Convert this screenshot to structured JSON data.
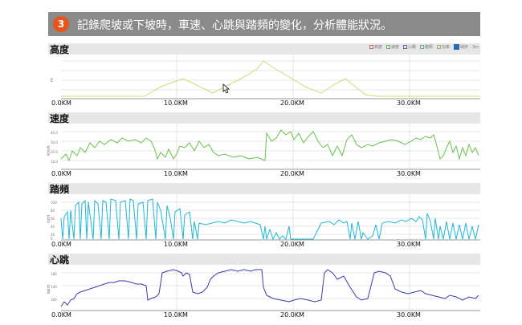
{
  "banner": {
    "step": "3",
    "title": "記錄爬坡或下坡時，車速、心跳與踏頻的變化，分析體能狀況。"
  },
  "legend": [
    {
      "label": "高度",
      "color": "#c66"
    },
    {
      "label": "速度",
      "color": "#6a6"
    },
    {
      "label": "心跳",
      "color": "#66a"
    },
    {
      "label": "踏頻",
      "color": "#6aa"
    },
    {
      "label": "功率",
      "color": "#aa6"
    }
  ],
  "legend_extra": [
    "儲存",
    "3m"
  ],
  "x_ticks": [
    "0.0KM",
    "10.0KM",
    "20.0KM",
    "30.0KM"
  ],
  "panels": [
    {
      "key": "altitude",
      "title": "高度",
      "unit": "m",
      "color": "#d4d870"
    },
    {
      "key": "speed",
      "title": "速度",
      "unit": "km/h",
      "color": "#66c24a",
      "y_ticks": [
        "40.0",
        "30.0",
        "20.0",
        "10.0"
      ]
    },
    {
      "key": "cadence",
      "title": "踏頻",
      "unit": "rpm",
      "color": "#1cb8d8",
      "y_ticks": [
        "100",
        "80",
        "60",
        "40",
        "20",
        "0"
      ]
    },
    {
      "key": "heart_rate",
      "title": "心跳",
      "unit": "bpm",
      "color": "#3a3ab0",
      "y_ticks": [
        "180",
        "140",
        "100"
      ]
    }
  ]
}
